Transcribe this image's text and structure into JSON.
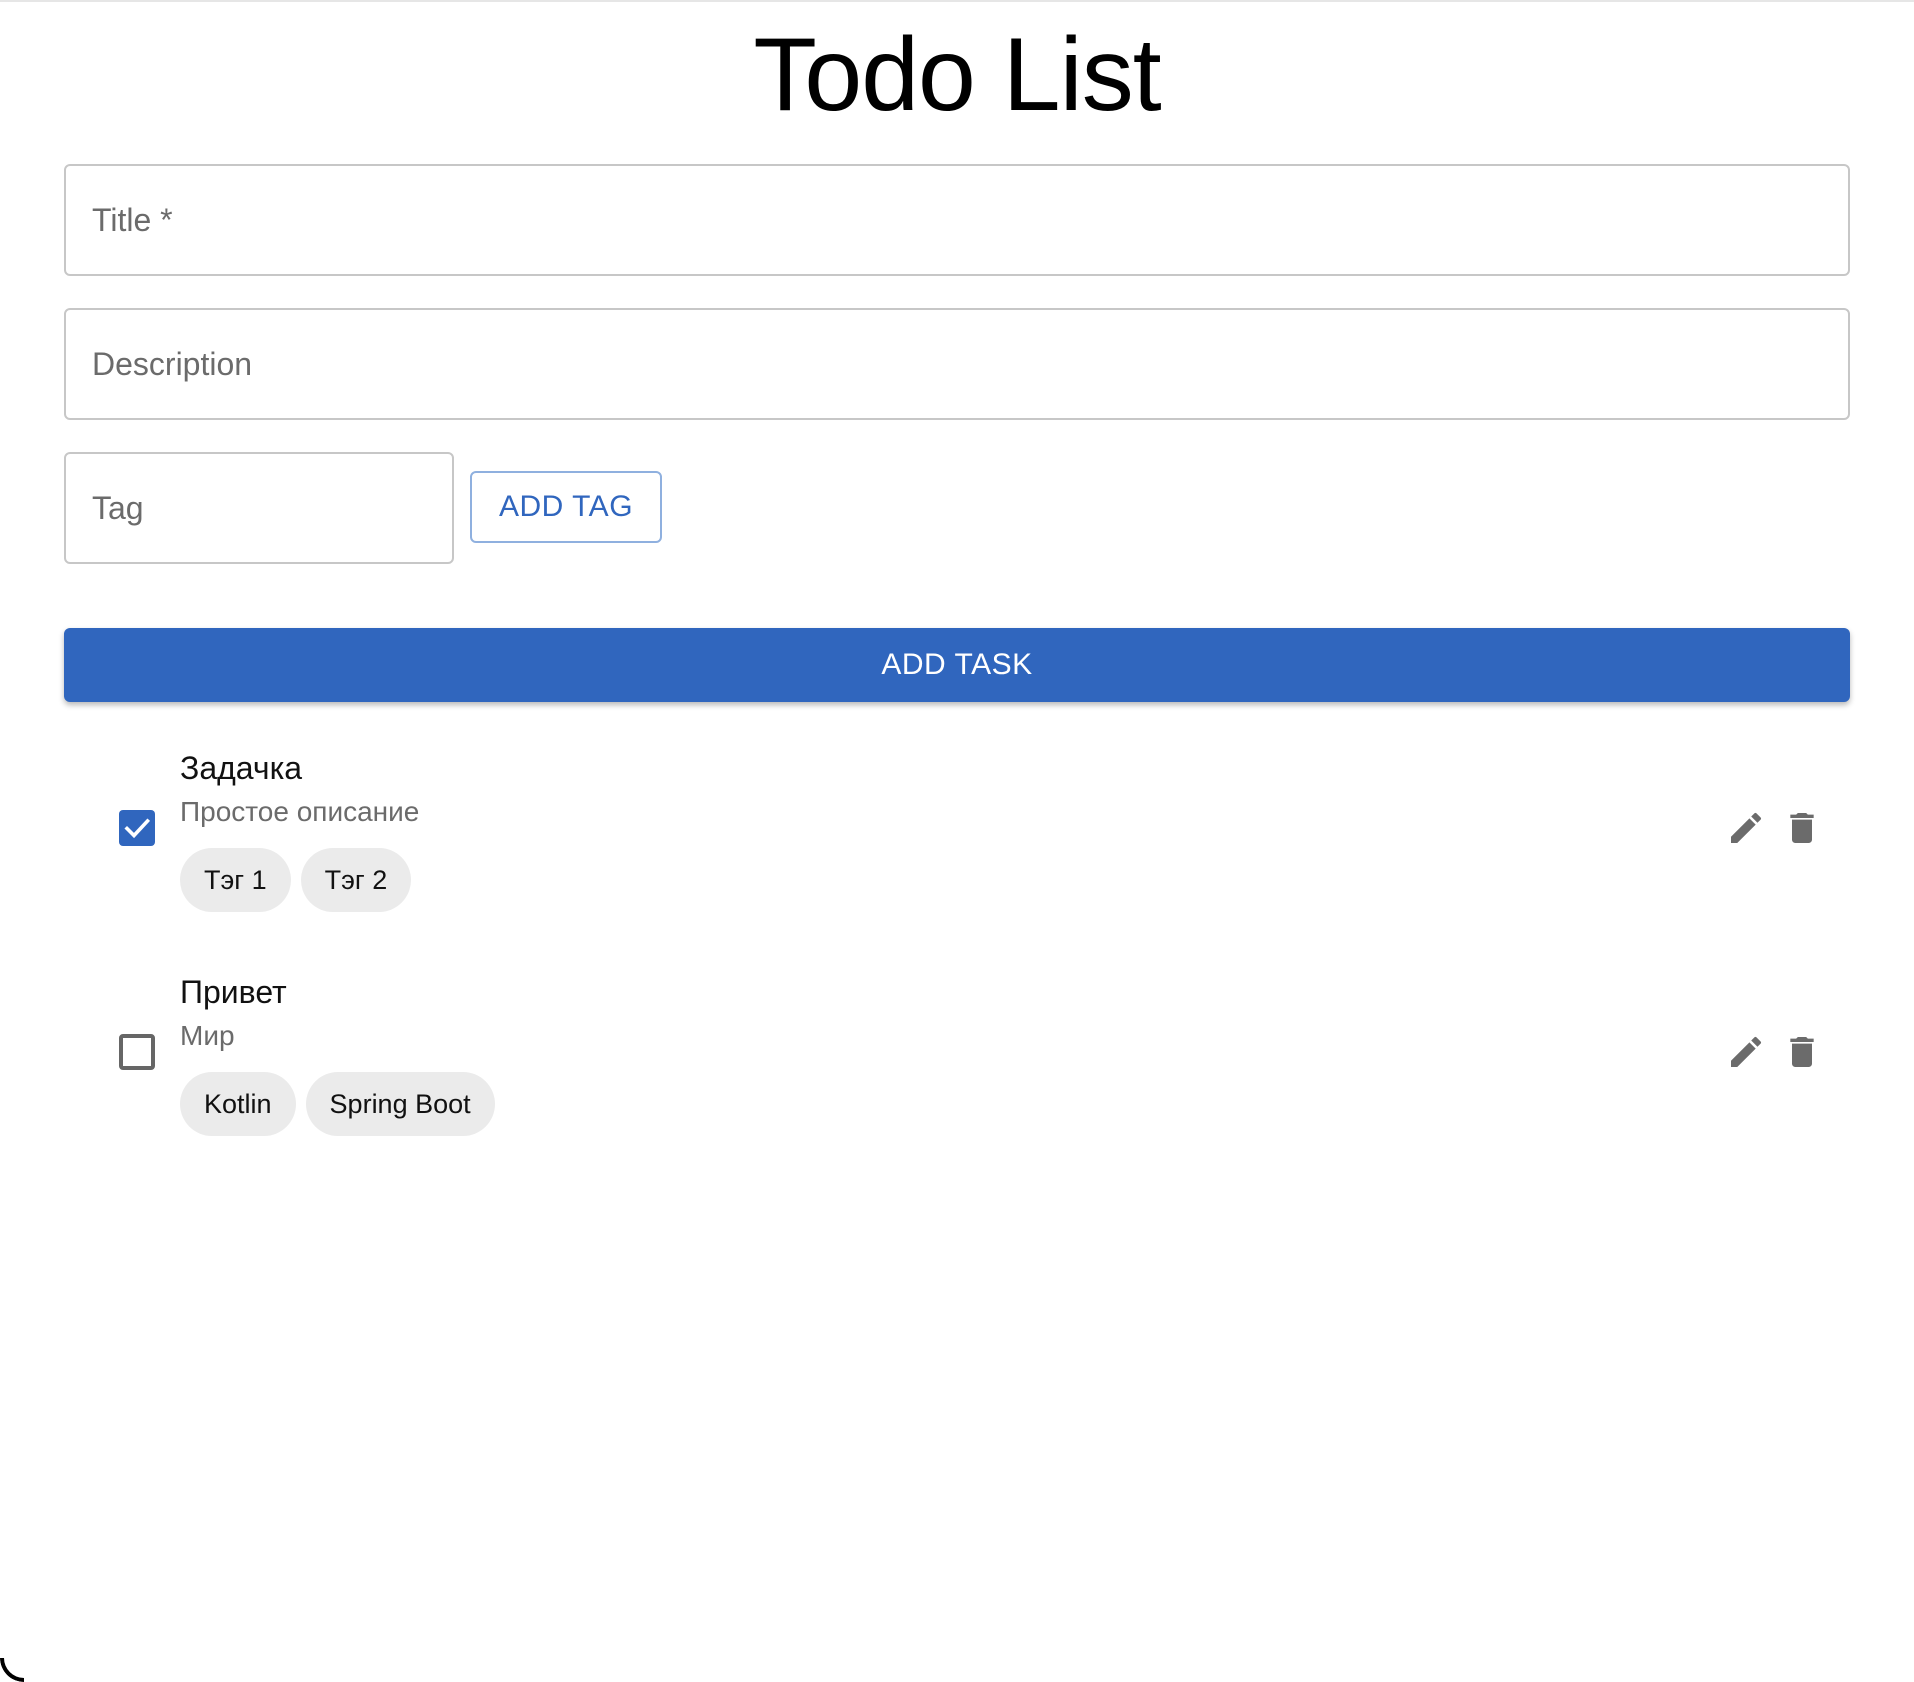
{
  "page": {
    "title": "Todo List"
  },
  "form": {
    "title_placeholder": "Title *",
    "description_placeholder": "Description",
    "tag_placeholder": "Tag",
    "add_tag_label": "ADD TAG",
    "add_task_label": "ADD TASK"
  },
  "colors": {
    "primary": "#3066be",
    "chip_bg": "#ebebeb",
    "secondary_text": "#6b6b6b",
    "icon": "#6b6b6b"
  },
  "todos": [
    {
      "title": "Задачка",
      "description": "Простое описание",
      "done": true,
      "tags": [
        "Тэг 1",
        "Тэг 2"
      ],
      "icons": {
        "checkbox": "checkbox-checked-icon",
        "edit": "pencil-icon",
        "delete": "trash-icon"
      }
    },
    {
      "title": "Привет",
      "description": "Мир",
      "done": false,
      "tags": [
        "Kotlin",
        "Spring Boot"
      ],
      "icons": {
        "checkbox": "checkbox-unchecked-icon",
        "edit": "pencil-icon",
        "delete": "trash-icon"
      }
    }
  ]
}
